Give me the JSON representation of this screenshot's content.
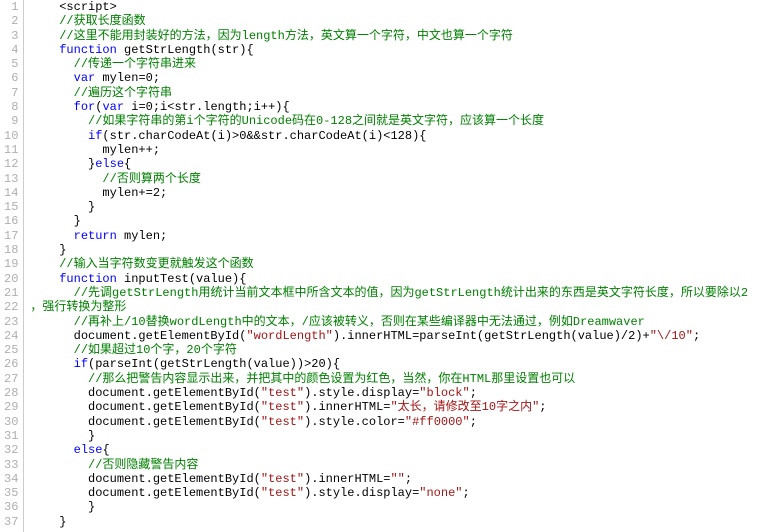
{
  "lines": [
    {
      "n": 1,
      "segs": [
        {
          "t": "    <script>",
          "c": "plain"
        }
      ]
    },
    {
      "n": 2,
      "segs": [
        {
          "t": "    ",
          "c": "plain"
        },
        {
          "t": "//获取长度函数",
          "c": "cmt"
        }
      ]
    },
    {
      "n": 3,
      "segs": [
        {
          "t": "    ",
          "c": "plain"
        },
        {
          "t": "//这里不能用封装好的方法，因为length方法，英文算一个字符，中文也算一个字符",
          "c": "cmt"
        }
      ]
    },
    {
      "n": 4,
      "segs": [
        {
          "t": "    ",
          "c": "plain"
        },
        {
          "t": "function",
          "c": "kw"
        },
        {
          "t": " getStrLength(str){",
          "c": "plain"
        }
      ]
    },
    {
      "n": 5,
      "segs": [
        {
          "t": "      ",
          "c": "plain"
        },
        {
          "t": "//传递一个字符串进来",
          "c": "cmt"
        }
      ]
    },
    {
      "n": 6,
      "segs": [
        {
          "t": "      ",
          "c": "plain"
        },
        {
          "t": "var",
          "c": "kw"
        },
        {
          "t": " mylen=0;",
          "c": "plain"
        }
      ]
    },
    {
      "n": 7,
      "segs": [
        {
          "t": "      ",
          "c": "plain"
        },
        {
          "t": "//遍历这个字符串",
          "c": "cmt"
        }
      ]
    },
    {
      "n": 8,
      "segs": [
        {
          "t": "      ",
          "c": "plain"
        },
        {
          "t": "for",
          "c": "kw"
        },
        {
          "t": "(",
          "c": "plain"
        },
        {
          "t": "var",
          "c": "kw"
        },
        {
          "t": " i=0;i<str.length;i++){",
          "c": "plain"
        }
      ]
    },
    {
      "n": 9,
      "segs": [
        {
          "t": "        ",
          "c": "plain"
        },
        {
          "t": "//如果字符串的第i个字符的Unicode码在0-128之间就是英文字符，应该算一个长度",
          "c": "cmt"
        }
      ]
    },
    {
      "n": 10,
      "segs": [
        {
          "t": "        ",
          "c": "plain"
        },
        {
          "t": "if",
          "c": "kw"
        },
        {
          "t": "(str.charCodeAt(i)>0&&str.charCodeAt(i)<128){",
          "c": "plain"
        }
      ]
    },
    {
      "n": 11,
      "segs": [
        {
          "t": "          mylen++;",
          "c": "plain"
        }
      ]
    },
    {
      "n": 12,
      "segs": [
        {
          "t": "        }",
          "c": "plain"
        },
        {
          "t": "else",
          "c": "kw"
        },
        {
          "t": "{",
          "c": "plain"
        }
      ]
    },
    {
      "n": 13,
      "segs": [
        {
          "t": "          ",
          "c": "plain"
        },
        {
          "t": "//否则算两个长度",
          "c": "cmt"
        }
      ]
    },
    {
      "n": 14,
      "segs": [
        {
          "t": "          mylen+=2;",
          "c": "plain"
        }
      ]
    },
    {
      "n": 15,
      "segs": [
        {
          "t": "        }",
          "c": "plain"
        }
      ]
    },
    {
      "n": 16,
      "segs": [
        {
          "t": "      }",
          "c": "plain"
        }
      ]
    },
    {
      "n": 17,
      "segs": [
        {
          "t": "      ",
          "c": "plain"
        },
        {
          "t": "return",
          "c": "kw"
        },
        {
          "t": " mylen;",
          "c": "plain"
        }
      ]
    },
    {
      "n": 18,
      "segs": [
        {
          "t": "    }",
          "c": "plain"
        }
      ]
    },
    {
      "n": 19,
      "segs": [
        {
          "t": "    ",
          "c": "plain"
        },
        {
          "t": "//输入当字符数变更就触发这个函数",
          "c": "cmt"
        }
      ]
    },
    {
      "n": 20,
      "segs": [
        {
          "t": "    ",
          "c": "plain"
        },
        {
          "t": "function",
          "c": "kw"
        },
        {
          "t": " inputTest(value){",
          "c": "plain"
        }
      ]
    },
    {
      "n": 21,
      "segs": [
        {
          "t": "      ",
          "c": "plain"
        },
        {
          "t": "//先调getStrLength用统计当前文本框中所含文本的值，因为getStrLength统计出来的东西是英文字符长度，所以要除以2",
          "c": "cmt"
        }
      ]
    },
    {
      "n": 22,
      "segs": [
        {
          "t": "，强行转换为整形",
          "c": "cmt"
        }
      ]
    },
    {
      "n": 23,
      "segs": [
        {
          "t": "      ",
          "c": "plain"
        },
        {
          "t": "//再补上/10替换wordLength中的文本，/应该被转义，否则在某些编译器中无法通过，例如Dreamwaver",
          "c": "cmt"
        }
      ]
    },
    {
      "n": 24,
      "segs": [
        {
          "t": "      document.getElementById(",
          "c": "plain"
        },
        {
          "t": "\"wordLength\"",
          "c": "str"
        },
        {
          "t": ").innerHTML=parseInt(getStrLength(value)/2)+",
          "c": "plain"
        },
        {
          "t": "\"\\/10\"",
          "c": "str"
        },
        {
          "t": ";",
          "c": "plain"
        }
      ]
    },
    {
      "n": 25,
      "segs": [
        {
          "t": "      ",
          "c": "plain"
        },
        {
          "t": "//如果超过10个字，20个字符",
          "c": "cmt"
        }
      ]
    },
    {
      "n": 26,
      "segs": [
        {
          "t": "      ",
          "c": "plain"
        },
        {
          "t": "if",
          "c": "kw"
        },
        {
          "t": "(parseInt(getStrLength(value))>20){",
          "c": "plain"
        }
      ]
    },
    {
      "n": 27,
      "segs": [
        {
          "t": "        ",
          "c": "plain"
        },
        {
          "t": "//那么把警告内容显示出来，并把其中的颜色设置为红色，当然，你在HTML那里设置也可以",
          "c": "cmt"
        }
      ]
    },
    {
      "n": 28,
      "segs": [
        {
          "t": "        document.getElementById(",
          "c": "plain"
        },
        {
          "t": "\"test\"",
          "c": "str"
        },
        {
          "t": ").style.display=",
          "c": "plain"
        },
        {
          "t": "\"block\"",
          "c": "str"
        },
        {
          "t": ";",
          "c": "plain"
        }
      ]
    },
    {
      "n": 29,
      "segs": [
        {
          "t": "        document.getElementById(",
          "c": "plain"
        },
        {
          "t": "\"test\"",
          "c": "str"
        },
        {
          "t": ").innerHTML=",
          "c": "plain"
        },
        {
          "t": "\"太长，请修改至10字之内\"",
          "c": "str"
        },
        {
          "t": ";",
          "c": "plain"
        }
      ]
    },
    {
      "n": 30,
      "segs": [
        {
          "t": "        document.getElementById(",
          "c": "plain"
        },
        {
          "t": "\"test\"",
          "c": "str"
        },
        {
          "t": ").style.color=",
          "c": "plain"
        },
        {
          "t": "\"#ff0000\"",
          "c": "str"
        },
        {
          "t": ";",
          "c": "plain"
        }
      ]
    },
    {
      "n": 31,
      "segs": [
        {
          "t": "        }",
          "c": "plain"
        }
      ]
    },
    {
      "n": 32,
      "segs": [
        {
          "t": "      ",
          "c": "plain"
        },
        {
          "t": "else",
          "c": "kw"
        },
        {
          "t": "{",
          "c": "plain"
        }
      ]
    },
    {
      "n": 33,
      "segs": [
        {
          "t": "        ",
          "c": "plain"
        },
        {
          "t": "//否则隐藏警告内容",
          "c": "cmt"
        }
      ]
    },
    {
      "n": 34,
      "segs": [
        {
          "t": "        document.getElementById(",
          "c": "plain"
        },
        {
          "t": "\"test\"",
          "c": "str"
        },
        {
          "t": ").innerHTML=",
          "c": "plain"
        },
        {
          "t": "\"\"",
          "c": "str"
        },
        {
          "t": ";",
          "c": "plain"
        }
      ]
    },
    {
      "n": 35,
      "segs": [
        {
          "t": "        document.getElementById(",
          "c": "plain"
        },
        {
          "t": "\"test\"",
          "c": "str"
        },
        {
          "t": ").style.display=",
          "c": "plain"
        },
        {
          "t": "\"none\"",
          "c": "str"
        },
        {
          "t": ";",
          "c": "plain"
        }
      ]
    },
    {
      "n": 36,
      "segs": [
        {
          "t": "        }",
          "c": "plain"
        }
      ]
    },
    {
      "n": 37,
      "segs": [
        {
          "t": "    }",
          "c": "plain"
        }
      ]
    }
  ]
}
